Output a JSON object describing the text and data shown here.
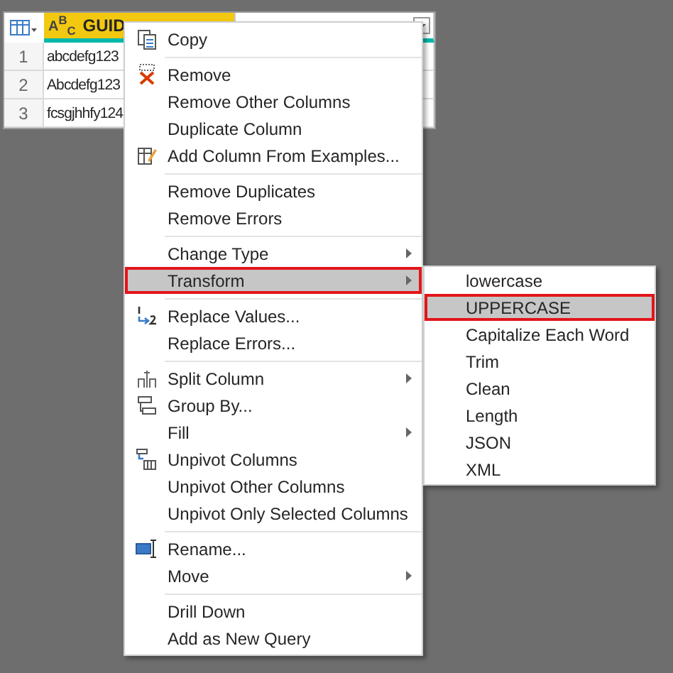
{
  "table": {
    "columns": [
      {
        "type_label": "A$^{B}$$_{C}$",
        "name": "GUID",
        "selected": true
      },
      {
        "selected": false
      }
    ],
    "rows": [
      {
        "number": "1",
        "cells": [
          "abcdefg123"
        ]
      },
      {
        "number": "2",
        "cells": [
          "Abcdefg123"
        ]
      },
      {
        "number": "3",
        "cells": [
          "fcsgjhhfy124"
        ]
      }
    ]
  },
  "context_menu": {
    "groups": [
      {
        "items": [
          {
            "label": "Copy",
            "kind": "copy",
            "submenu": false,
            "selected": false
          }
        ]
      },
      {
        "items": [
          {
            "label": "Remove",
            "kind": "remove",
            "submenu": false,
            "selected": false
          },
          {
            "label": "Remove Other Columns",
            "kind": "plain",
            "submenu": false,
            "selected": false
          },
          {
            "label": "Duplicate Column",
            "kind": "plain",
            "submenu": false,
            "selected": false
          },
          {
            "label": "Add Column From Examples...",
            "kind": "examples",
            "submenu": false,
            "selected": false
          }
        ]
      },
      {
        "items": [
          {
            "label": "Remove Duplicates",
            "kind": "plain",
            "submenu": false,
            "selected": false
          },
          {
            "label": "Remove Errors",
            "kind": "plain",
            "submenu": false,
            "selected": false
          }
        ]
      },
      {
        "items": [
          {
            "label": "Change Type",
            "kind": "plain",
            "submenu": true,
            "selected": false
          },
          {
            "label": "Transform",
            "kind": "plain",
            "submenu": true,
            "selected": true
          }
        ]
      },
      {
        "items": [
          {
            "label": "Replace Values...",
            "kind": "replace",
            "submenu": false,
            "selected": false
          },
          {
            "label": "Replace Errors...",
            "kind": "plain",
            "submenu": false,
            "selected": false
          }
        ]
      },
      {
        "items": [
          {
            "label": "Split Column",
            "kind": "split",
            "submenu": true,
            "selected": false
          },
          {
            "label": "Group By...",
            "kind": "group",
            "submenu": false,
            "selected": false
          },
          {
            "label": "Fill",
            "kind": "plain",
            "submenu": true,
            "selected": false
          },
          {
            "label": "Unpivot Columns",
            "kind": "unpivot",
            "submenu": false,
            "selected": false
          },
          {
            "label": "Unpivot Other Columns",
            "kind": "plain",
            "submenu": false,
            "selected": false
          },
          {
            "label": "Unpivot Only Selected Columns",
            "kind": "plain",
            "submenu": false,
            "selected": false
          }
        ]
      },
      {
        "items": [
          {
            "label": "Rename...",
            "kind": "rename",
            "submenu": false,
            "selected": false
          },
          {
            "label": "Move",
            "kind": "plain",
            "submenu": true,
            "selected": false
          }
        ]
      },
      {
        "items": [
          {
            "label": "Drill Down",
            "kind": "plain",
            "submenu": false,
            "selected": false
          },
          {
            "label": "Add as New Query",
            "kind": "plain",
            "submenu": false,
            "selected": false
          }
        ]
      }
    ]
  },
  "transform_submenu": {
    "items": [
      {
        "label": "lowercase",
        "selected": false
      },
      {
        "label": "UPPERCASE",
        "selected": true
      },
      {
        "label": "Capitalize Each Word",
        "selected": false
      },
      {
        "label": "Trim",
        "selected": false
      },
      {
        "label": "Clean",
        "selected": false
      },
      {
        "label": "Length",
        "selected": false
      },
      {
        "label": "JSON",
        "selected": false
      },
      {
        "label": "XML",
        "selected": false
      }
    ]
  }
}
